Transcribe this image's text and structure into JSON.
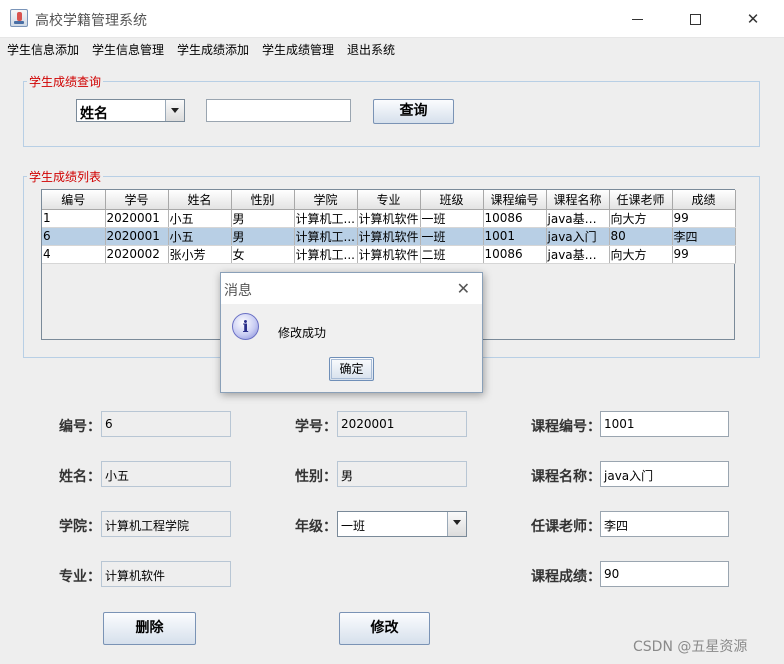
{
  "window": {
    "title": "高校学籍管理系统"
  },
  "menu": [
    "学生信息添加",
    "学生信息管理",
    "学生成绩添加",
    "学生成绩管理",
    "退出系统"
  ],
  "query": {
    "legend": "学生成绩查询",
    "field_selected": "姓名",
    "input_value": "",
    "button_label": "查询"
  },
  "list": {
    "legend": "学生成绩列表",
    "columns": [
      "编号",
      "学号",
      "姓名",
      "性别",
      "学院",
      "专业",
      "班级",
      "课程编号",
      "课程名称",
      "任课老师",
      "成绩"
    ],
    "rows": [
      [
        "1",
        "2020001",
        "小五",
        "男",
        "计算机工...",
        "计算机软件",
        "一班",
        "10086",
        "java基础...",
        "向大方",
        "99"
      ],
      [
        "6",
        "2020001",
        "小五",
        "男",
        "计算机工...",
        "计算机软件",
        "一班",
        "1001",
        "java入门",
        "80",
        "李四"
      ],
      [
        "4",
        "2020002",
        "张小芳",
        "女",
        "计算机工...",
        "计算机软件",
        "二班",
        "10086",
        "java基础...",
        "向大方",
        "99"
      ]
    ],
    "selected_index": 1
  },
  "form": {
    "id": {
      "label": "编号：",
      "value": "6"
    },
    "student_no": {
      "label": "学号：",
      "value": "2020001"
    },
    "course_no": {
      "label": "课程编号：",
      "value": "1001"
    },
    "name": {
      "label": "姓名：",
      "value": "小五"
    },
    "gender": {
      "label": "性别：",
      "value": "男"
    },
    "course_name": {
      "label": "课程名称：",
      "value": "java入门"
    },
    "college": {
      "label": "学院：",
      "value": "计算机工程学院"
    },
    "grade": {
      "label": "年级：",
      "value": "一班"
    },
    "teacher": {
      "label": "任课老师：",
      "value": "李四"
    },
    "major": {
      "label": "专业：",
      "value": "计算机软件"
    },
    "score": {
      "label": "课程成绩：",
      "value": "90"
    }
  },
  "actions": {
    "delete_label": "删除",
    "update_label": "修改"
  },
  "dialog": {
    "title": "消息",
    "message": "修改成功",
    "ok_label": "确定",
    "icon": "info-icon"
  },
  "watermark": "CSDN @五星资源"
}
